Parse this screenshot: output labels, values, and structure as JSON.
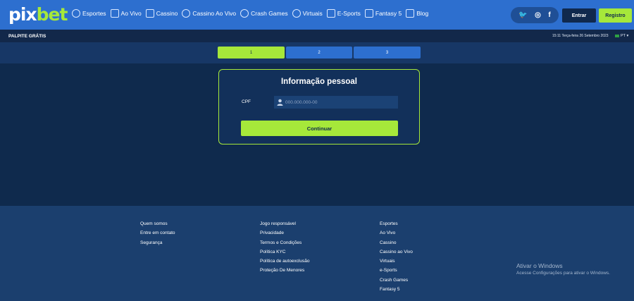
{
  "logo": {
    "part1": "pix",
    "part2": "bet"
  },
  "nav": [
    {
      "label": "Esportes",
      "icon": "soccer-ball-icon"
    },
    {
      "label": "Ao Vivo",
      "icon": "live-icon"
    },
    {
      "label": "Cassino",
      "icon": "cards-icon"
    },
    {
      "label": "Cassino Ao Vivo",
      "icon": "roulette-icon"
    },
    {
      "label": "Crash Games",
      "icon": "rocket-icon"
    },
    {
      "label": "Virtuais",
      "icon": "virtual-icon"
    },
    {
      "label": "E-Sports",
      "icon": "gamepad-icon"
    },
    {
      "label": "Fantasy 5",
      "icon": "fantasy-icon"
    },
    {
      "label": "Blog",
      "icon": "blog-icon"
    }
  ],
  "socials": {
    "twitter": "🐦",
    "instagram": "◎",
    "facebook": "f"
  },
  "auth": {
    "login": "Entrar",
    "register": "Registro"
  },
  "subbar": {
    "promo": "PALPITE GRÁTIS",
    "datetime": "15:11 Terça-feira 26 Setembro 2023",
    "lang": "PT"
  },
  "steps": [
    "1",
    "2",
    "3"
  ],
  "form": {
    "title": "Informação pessoal",
    "cpf_label": "CPF",
    "cpf_placeholder": "000.000.000-00",
    "cpf_value": "",
    "submit": "Continuar"
  },
  "footer": {
    "col1": [
      "Quem somos",
      "Entre em contato",
      "Segurança"
    ],
    "col2": [
      "Jogo responsável",
      "Privacidade",
      "Termos e Condições",
      "Política KYC",
      "Política de autoexclusão",
      "Proteção De Menores"
    ],
    "col3": [
      "Esportes",
      "Ao Vivo",
      "Cassino",
      "Cassino ao Vivo",
      "Virtuais",
      "e-Sports",
      "Crash Games",
      "Fantasy 5"
    ]
  },
  "watermark": {
    "line1": "Ativar o Windows",
    "line2": "Acesse Configurações para ativar o Windows."
  },
  "colors": {
    "primary": "#2d6fcf",
    "accent": "#a6e83a",
    "background": "#0f2a4d"
  }
}
